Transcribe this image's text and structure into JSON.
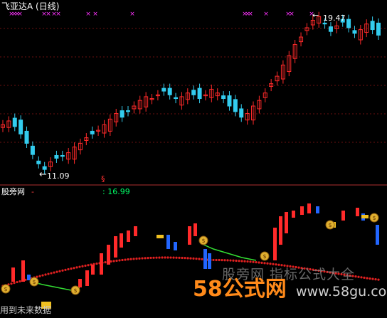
{
  "chart_title": "飞亚达A (日线)",
  "price_max_label": "19.47",
  "price_min_label": "11.09",
  "arrow_glyph": "←",
  "signal_mark": "§",
  "indicator_name": "股旁网",
  "indicator_dash": "-",
  "indicator_value": ": 16.99",
  "watermark_mid": "股旁网  指标公式大全",
  "watermark_logo": "58公式网",
  "watermark_url": "www.58gu.com",
  "bottom_text": "用到未来数据",
  "colors": {
    "up": "#ff2a2a",
    "down": "#33ccee",
    "magenta": "#ff33ff",
    "dotline": "#e02020",
    "greenline": "#33dd33",
    "gold": "#f0c020",
    "blue": "#2266ff",
    "grid": "#6a1010",
    "separator": "#b03030"
  },
  "chart_data": [
    {
      "type": "candlestick",
      "title": "飞亚达A (日线)",
      "marked_high": 19.47,
      "marked_low": 11.09,
      "series_close_approx": [
        13.6,
        13.8,
        13.5,
        13.1,
        12.6,
        12.0,
        11.5,
        11.2,
        11.6,
        11.8,
        11.9,
        12.1,
        12.4,
        12.6,
        12.9,
        13.1,
        13.3,
        13.6,
        13.9,
        14.2,
        14.0,
        14.3,
        14.6,
        14.9,
        15.1,
        15.0,
        15.2,
        15.4,
        15.2,
        15.0,
        15.1,
        15.3,
        15.2,
        15.0,
        15.2,
        15.5,
        15.3,
        15.0,
        14.6,
        14.3,
        14.0,
        14.2,
        14.6,
        14.9,
        15.3,
        15.8,
        16.2,
        16.8,
        17.3,
        17.9,
        18.3,
        18.8,
        19.2,
        19.4,
        19.0,
        18.6,
        18.9,
        19.1,
        18.8,
        18.5,
        18.7,
        19.0,
        18.7,
        18.4
      ]
    },
    {
      "type": "line",
      "name": "股旁网",
      "current_value": 16.99
    }
  ]
}
